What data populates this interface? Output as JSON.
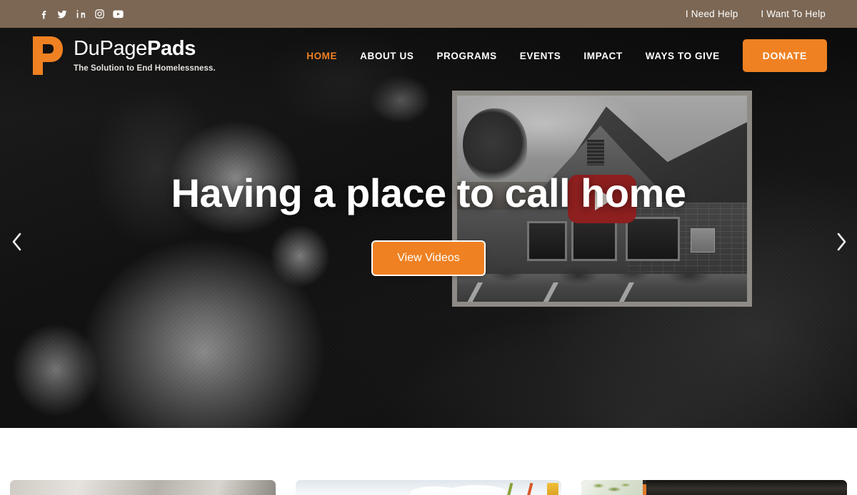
{
  "topbar": {
    "social": [
      {
        "name": "facebook-icon",
        "label": "Facebook"
      },
      {
        "name": "twitter-icon",
        "label": "Twitter"
      },
      {
        "name": "linkedin-icon",
        "label": "LinkedIn"
      },
      {
        "name": "instagram-icon",
        "label": "Instagram"
      },
      {
        "name": "youtube-icon",
        "label": "YouTube"
      }
    ],
    "need_help": "I Need Help",
    "want_to_help": "I Want To Help",
    "background_color": "#7b6754"
  },
  "header": {
    "logo": {
      "word_light": "DuPage",
      "word_bold": "Pads",
      "tagline": "The Solution to End Homelessness.",
      "mark_color": "#ef8122"
    },
    "nav": [
      {
        "label": "HOME",
        "active": true
      },
      {
        "label": "ABOUT US",
        "active": false
      },
      {
        "label": "PROGRAMS",
        "active": false
      },
      {
        "label": "EVENTS",
        "active": false
      },
      {
        "label": "IMPACT",
        "active": false
      },
      {
        "label": "WAYS TO GIVE",
        "active": false
      }
    ],
    "donate_label": "DONATE",
    "accent_color": "#ef8122"
  },
  "hero": {
    "headline": "Having a place to call home",
    "cta_label": "View Videos",
    "prev_arrow": "‹",
    "next_arrow": "›",
    "video": {
      "play_button_color": "#8d1f1f",
      "caption": ""
    }
  },
  "cards": [
    {
      "id": "card-1",
      "label": ""
    },
    {
      "id": "card-2",
      "label": ""
    },
    {
      "id": "card-3",
      "label": ""
    }
  ]
}
